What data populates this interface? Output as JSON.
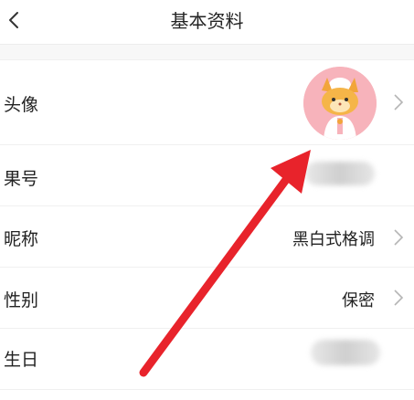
{
  "header": {
    "title": "基本资料"
  },
  "rows": {
    "avatar": {
      "label": "头像"
    },
    "id": {
      "label": "果号"
    },
    "nickname": {
      "label": "昵称",
      "value": "黑白式格调"
    },
    "gender": {
      "label": "性别",
      "value": "保密"
    },
    "birthday": {
      "label": "生日"
    }
  },
  "annotation": {
    "color": "#e8232b"
  }
}
